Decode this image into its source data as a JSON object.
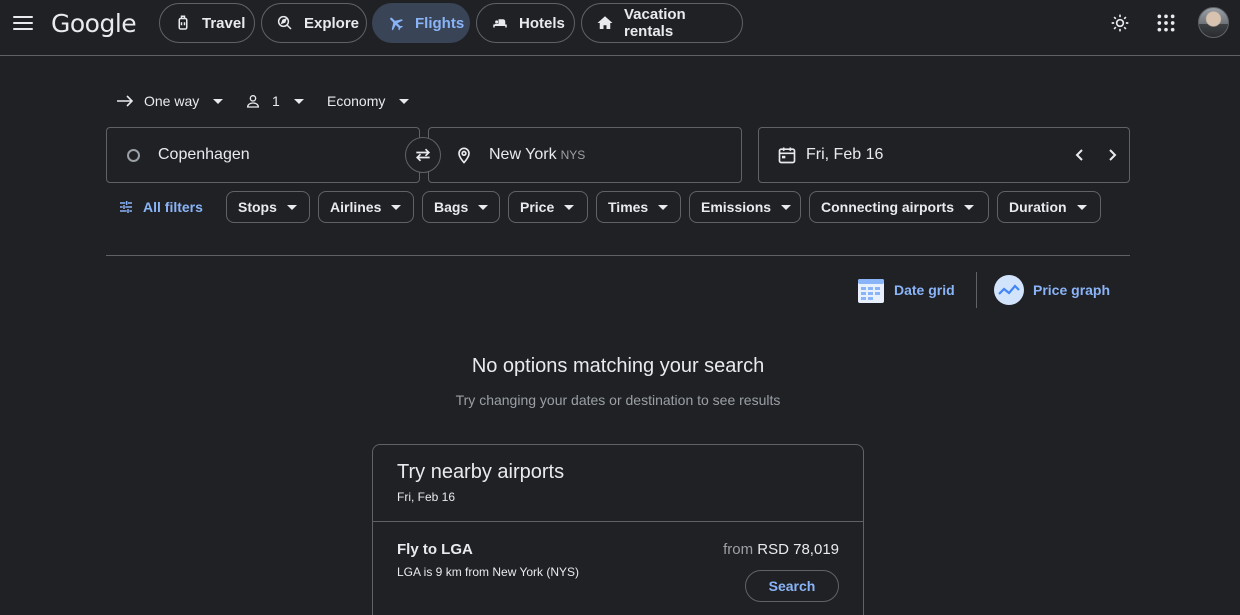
{
  "header": {
    "logo": "Google",
    "nav": [
      {
        "label": "Travel",
        "icon": "suitcase-icon",
        "active": false
      },
      {
        "label": "Explore",
        "icon": "explore-icon",
        "active": false
      },
      {
        "label": "Flights",
        "icon": "airplane-icon",
        "active": true
      },
      {
        "label": "Hotels",
        "icon": "bed-icon",
        "active": false
      },
      {
        "label": "Vacation rentals",
        "icon": "house-icon",
        "active": false
      }
    ]
  },
  "search": {
    "trip_type": "One way",
    "passengers": "1",
    "cabin_class": "Economy",
    "origin": "Copenhagen",
    "destination": "New York",
    "destination_code": "NYS",
    "date": "Fri, Feb 16"
  },
  "filters": {
    "all_filters_label": "All filters",
    "chips": [
      "Stops",
      "Airlines",
      "Bags",
      "Price",
      "Times",
      "Emissions",
      "Connecting airports",
      "Duration"
    ]
  },
  "tools": {
    "date_grid": "Date grid",
    "price_graph": "Price graph"
  },
  "empty_state": {
    "title": "No options matching your search",
    "subtitle": "Try changing your dates or destination to see results"
  },
  "nearby": {
    "title": "Try nearby airports",
    "date": "Fri, Feb 16",
    "row": {
      "title": "Fly to LGA",
      "subtitle": "LGA is 9 km from New York (NYS)",
      "price_prefix": "from",
      "price": "RSD 78,019",
      "button": "Search"
    }
  },
  "colors": {
    "background": "#202124",
    "accent": "#8ab4f8",
    "active_chip": "#394457",
    "border": "#5f6368"
  }
}
